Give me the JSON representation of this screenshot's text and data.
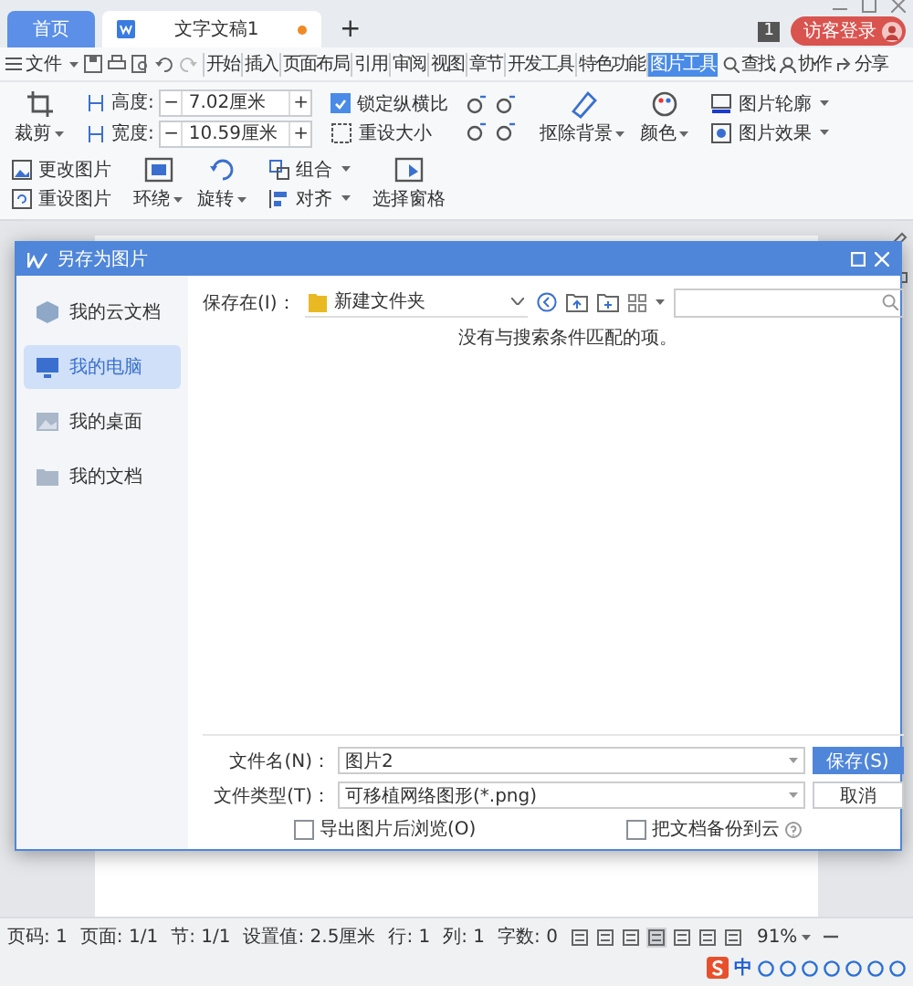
{
  "title_bar": {
    "tabs": [
      {
        "label": "首页",
        "kind": "home",
        "selected": false,
        "unsaved": false
      },
      {
        "label": "文字文稿1",
        "kind": "document",
        "selected": true,
        "unsaved": true
      }
    ],
    "new_tab": "+",
    "badge": "1",
    "login": "访客登录"
  },
  "menu_bar": {
    "file_menu": "文件",
    "tabs": [
      {
        "label": "开始",
        "selected": false
      },
      {
        "label": "插入",
        "selected": false
      },
      {
        "label": "页面布局",
        "selected": false
      },
      {
        "label": "引用",
        "selected": false
      },
      {
        "label": "审阅",
        "selected": false
      },
      {
        "label": "视图",
        "selected": false
      },
      {
        "label": "章节",
        "selected": false
      },
      {
        "label": "开发工具",
        "selected": false
      },
      {
        "label": "特色功能",
        "selected": false
      },
      {
        "label": "图片工具",
        "selected": true
      }
    ],
    "actions": [
      "查找",
      "协作",
      "分享"
    ]
  },
  "ribbon": {
    "groups": [
      {
        "items": [
          {
            "kind": "large",
            "label": "裁剪",
            "dropdown": true
          }
        ]
      },
      {
        "items": [
          {
            "kind": "spinner",
            "label": "高度:",
            "value": "7.02厘米",
            "decrease": "−",
            "increase": "+"
          },
          {
            "kind": "spinner",
            "label": "宽度:",
            "value": "10.59厘米",
            "decrease": "−",
            "increase": "+"
          }
        ]
      },
      {
        "items": [
          {
            "kind": "checkbox",
            "label": "锁定纵横比",
            "checked": true
          },
          {
            "kind": "small",
            "label": "重设大小",
            "dropdown": false
          }
        ]
      },
      {
        "items": [
          {
            "kind": "icon_grid"
          }
        ]
      },
      {
        "items": [
          {
            "kind": "large",
            "label": "抠除背景",
            "dropdown": true
          },
          {
            "kind": "large",
            "label": "颜色",
            "dropdown": true
          }
        ]
      },
      {
        "items": [
          {
            "kind": "small",
            "label": "图片轮廓",
            "dropdown": true
          },
          {
            "kind": "small",
            "label": "图片效果",
            "dropdown": true
          }
        ]
      },
      {
        "items": [
          {
            "kind": "small",
            "label": "更改图片",
            "dropdown": false
          },
          {
            "kind": "small",
            "label": "重设图片",
            "dropdown": false
          }
        ]
      },
      {
        "items": [
          {
            "kind": "large",
            "label": "环绕",
            "dropdown": true
          },
          {
            "kind": "large",
            "label": "旋转",
            "dropdown": true
          }
        ]
      },
      {
        "items": [
          {
            "kind": "small",
            "label": "组合",
            "dropdown": true
          },
          {
            "kind": "small",
            "label": "对齐",
            "dropdown": true
          }
        ]
      },
      {
        "items": [
          {
            "kind": "large",
            "label": "选择窗格",
            "dropdown": false
          }
        ]
      }
    ]
  },
  "dialog": {
    "title": "另存为图片",
    "sidebar": [
      {
        "label": "我的云文档",
        "selected": false
      },
      {
        "label": "我的电脑",
        "selected": true
      },
      {
        "label": "我的桌面",
        "selected": false
      },
      {
        "label": "我的文档",
        "selected": false
      }
    ],
    "location_label": "保存在(I)：",
    "location": "新建文件夹",
    "message": "没有与搜索条件匹配的项。",
    "file_name_label": "文件名(N)：",
    "file_name": "图片2",
    "file_type_label": "文件类型(T)：",
    "file_type": "可移植网络图形(*.png)",
    "buttons": [
      {
        "label": "保存(S)",
        "primary": true
      },
      {
        "label": "取消",
        "primary": false
      }
    ],
    "options": [
      {
        "label": "导出图片后浏览(O)",
        "checked": false,
        "help": false
      },
      {
        "label": "把文档备份到云",
        "checked": false,
        "help": true
      }
    ]
  },
  "status_bar": {
    "items": [
      "页码: 1",
      "页面: 1/1",
      "节: 1/1",
      "设置值: 2.5厘米",
      "行: 1",
      "列: 1",
      "字数: 0"
    ],
    "view_modes": [
      {
        "selected": false
      },
      {
        "selected": false
      },
      {
        "selected": false
      },
      {
        "selected": true
      },
      {
        "selected": false
      },
      {
        "selected": false
      },
      {
        "selected": false
      }
    ],
    "zoom": "91%",
    "ime_mode": "中"
  }
}
